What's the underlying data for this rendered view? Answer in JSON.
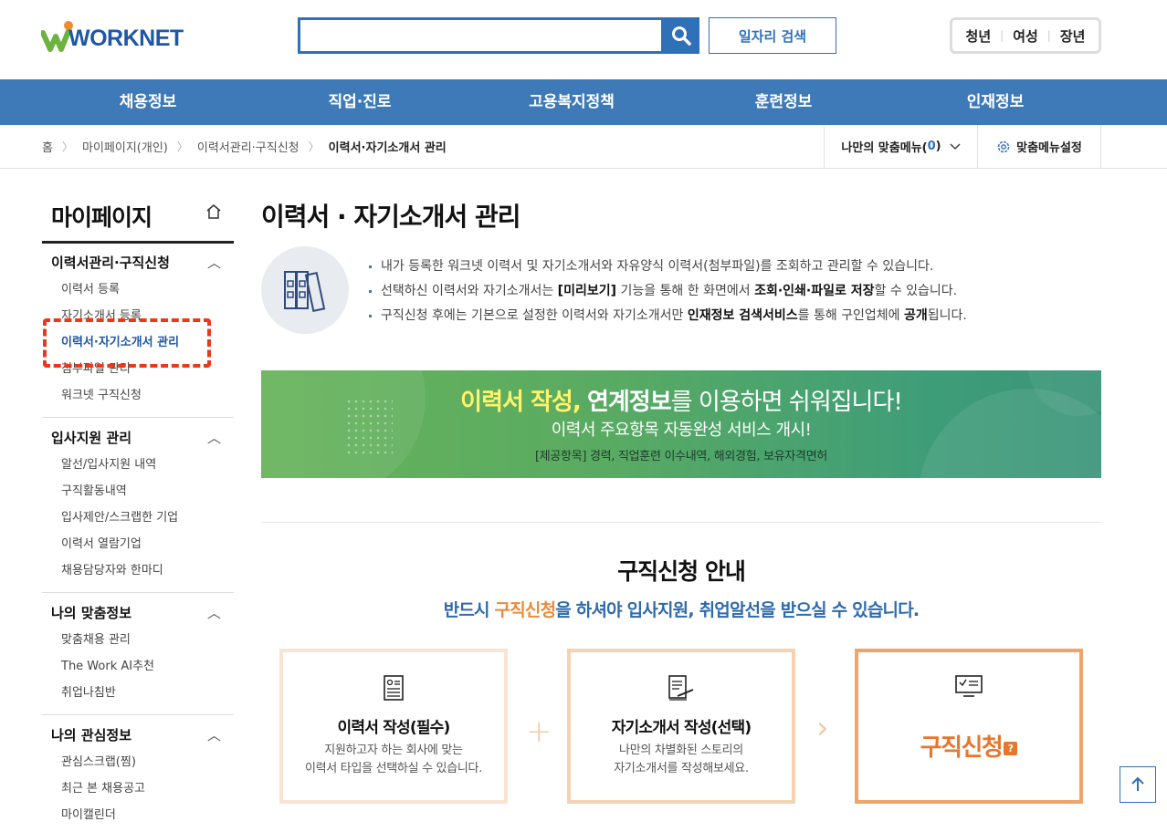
{
  "header": {
    "logo_text": "WORKNET",
    "search_placeholder": "",
    "job_search_label": "일자리 검색",
    "quick_links": [
      "청년",
      "여성",
      "장년"
    ]
  },
  "gnb": [
    "채용정보",
    "직업·진로",
    "고용복지정책",
    "훈련정보",
    "인재정보"
  ],
  "breadcrumb": {
    "home": "홈",
    "items": [
      "마이페이지(개인)",
      "이력서관리·구직신청"
    ],
    "current": "이력서·자기소개서 관리"
  },
  "my_menu": {
    "label": "나만의 맞춤메뉴(",
    "count": "0",
    "close": ")"
  },
  "menu_setting": "맞춤메뉴설정",
  "sidebar": {
    "title": "마이페이지",
    "groups": [
      {
        "title": "이력서관리·구직신청",
        "items": [
          "이력서 등록",
          "자기소개서 등록",
          "이력서·자기소개서 관리",
          "첨부파일 관리",
          "워크넷 구직신청"
        ]
      },
      {
        "title": "입사지원 관리",
        "items": [
          "알선/입사지원 내역",
          "구직활동내역",
          "입사제안/스크랩한 기업",
          "이력서 열람기업",
          "채용담당자와 한마디"
        ]
      },
      {
        "title": "나의 맞춤정보",
        "items": [
          "맞춤채용 관리",
          "The Work AI추천",
          "취업나침반"
        ]
      },
      {
        "title": "나의 관심정보",
        "items": [
          "관심스크랩(찜)",
          "최근 본 채용공고",
          "마이캘린더"
        ]
      }
    ]
  },
  "main": {
    "title": "이력서 · 자기소개서 관리",
    "intro": [
      {
        "a": "내가 등록한 워크넷 이력서 및 자기소개서와 자유양식 이력서(첨부파일)를 조회하고 관리할 수 있습니다.",
        "b1": "",
        "c": "",
        "b2": "",
        "d": ""
      },
      {
        "a": "선택하신 이력서와 자기소개서는 ",
        "b1": "[미리보기]",
        "c": " 기능을 통해 한 화면에서 ",
        "b2": "조회·인쇄·파일로 저장",
        "d": "할 수 있습니다."
      },
      {
        "a": "구직신청 후에는 기본으로 설정한 이력서와 자기소개서만 ",
        "b1": "인재정보 검색서비스",
        "c": "를 통해 구인업체에 ",
        "b2": "공개",
        "d": "됩니다."
      }
    ],
    "banner": {
      "line1_yellow": "이력서 작성,",
      "line1_bold": "연계정보",
      "line1_rest": "를 이용하면 쉬워집니다!",
      "line2": "이력서 주요항목 자동완성 서비스 개시!",
      "line3": "[제공항목] 경력, 직업훈련 이수내역, 해외경험, 보유자격면허"
    },
    "guide": {
      "title": "구직신청 안내",
      "sub_a": "반드시 ",
      "sub_o": "구직신청",
      "sub_b": "을 하셔야 입사지원, 취업알선을 받으실 수 있습니다."
    },
    "steps": [
      {
        "title": "이력서 작성(필수)",
        "desc1": "지원하고자 하는 회사에 맞는",
        "desc2": "이력서 타입을 선택하실 수 있습니다."
      },
      {
        "title": "자기소개서 작성(선택)",
        "desc1": "나만의 차별화된 스토리의",
        "desc2": "자기소개서를 작성해보세요."
      },
      {
        "title": "구직신청",
        "badge": "?"
      }
    ]
  },
  "colors": {
    "primary": "#3e79b8",
    "accent_orange": "#e8762b",
    "highlight": "#e8391e"
  }
}
